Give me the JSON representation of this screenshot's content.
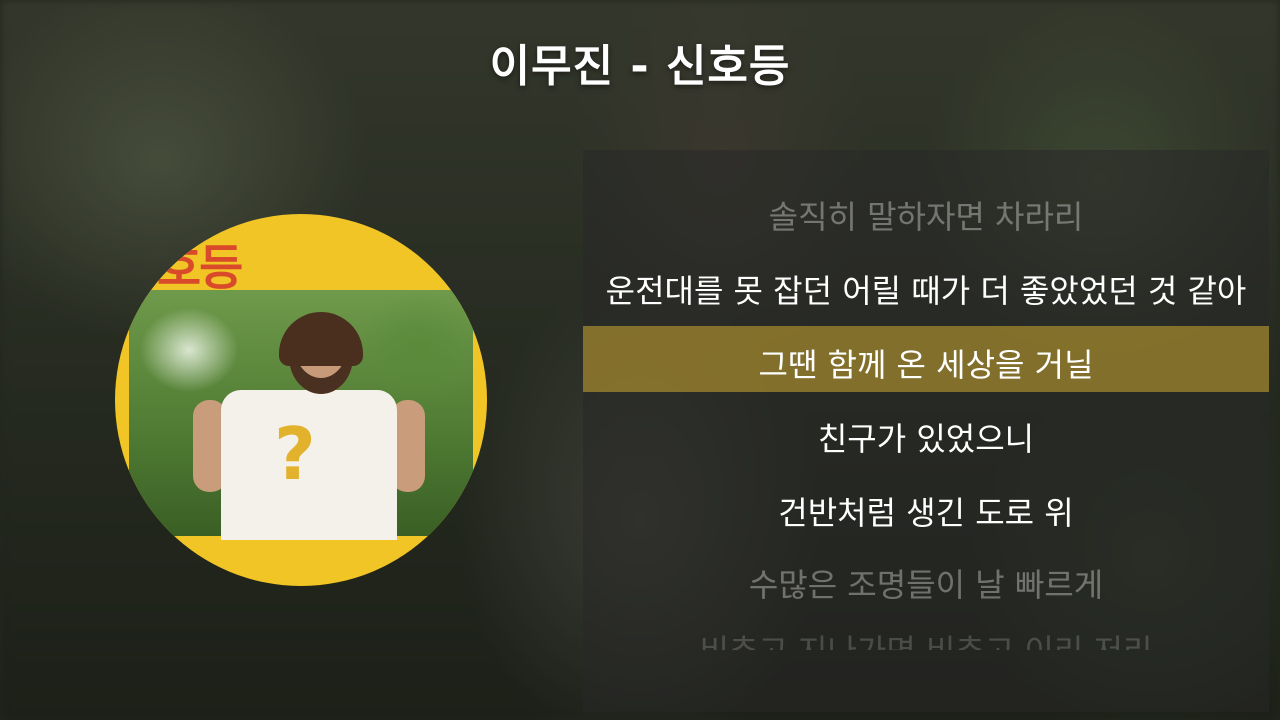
{
  "header": {
    "title": "이무진 - 신호등"
  },
  "album": {
    "cover_text": "호등",
    "shirt_symbol": "?"
  },
  "lyrics": [
    {
      "text": "솔직히 말하자면 차라리",
      "state": "past"
    },
    {
      "text": "운전대를 못 잡던 어릴 때가 더 좋았었던 것 같아",
      "state": "normal"
    },
    {
      "text": "그땐 함께 온 세상을 거닐",
      "state": "current"
    },
    {
      "text": "친구가 있었으니",
      "state": "normal"
    },
    {
      "text": "건반처럼 생긴 도로 위",
      "state": "normal"
    },
    {
      "text": "수많은 조명들이 날 빠르게",
      "state": "upcoming"
    },
    {
      "text": "비추고 지나가면 비추고 이리 저리",
      "state": "faded"
    }
  ],
  "colors": {
    "highlight": "#cdaa32",
    "album_bg": "#f1c525",
    "text": "#ffffff"
  }
}
